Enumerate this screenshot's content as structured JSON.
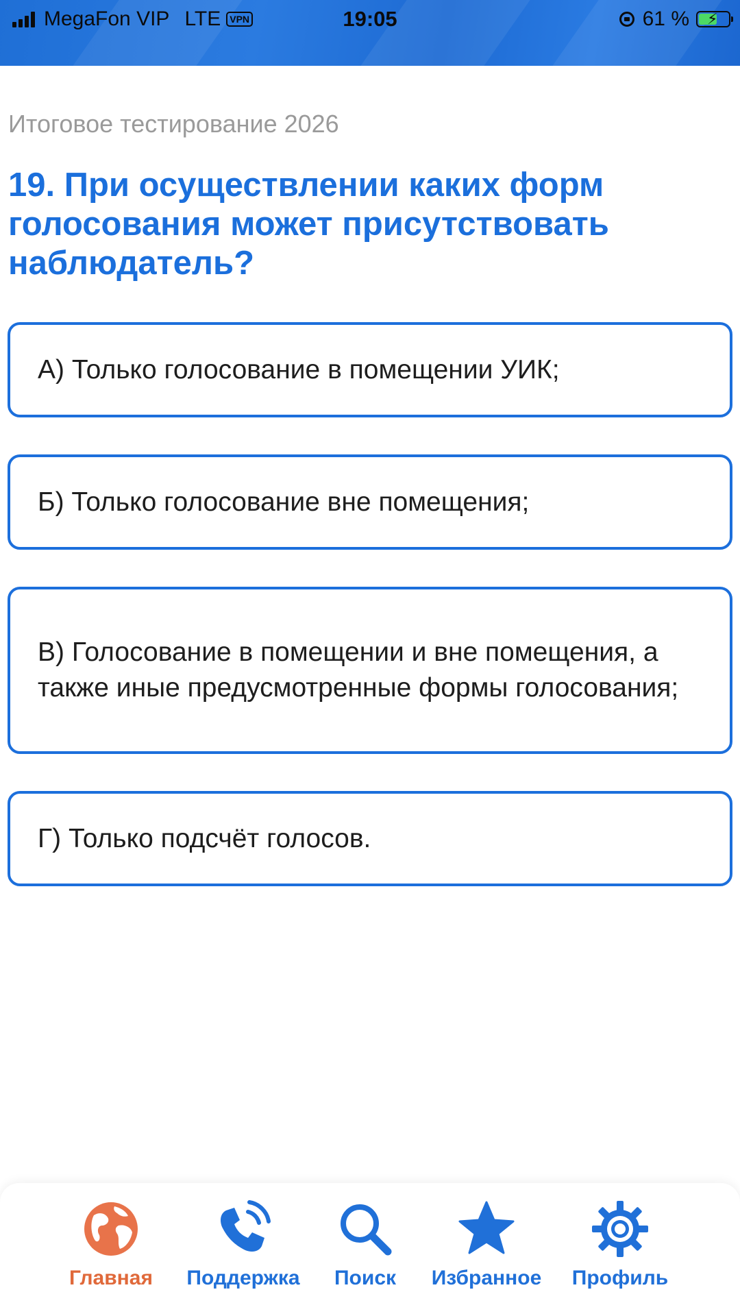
{
  "status_bar": {
    "carrier": "MegaFon VIP",
    "network": "LTE",
    "vpn": "VPN",
    "time": "19:05",
    "battery_percent": "61 %",
    "battery_level": 0.61,
    "battery_color": "#4cd964"
  },
  "header": {
    "subtitle": "Итоговое тестирование 2026"
  },
  "question": {
    "text": "19. При осуществлении каких форм голосования может присутствовать наблюдатель?"
  },
  "options": [
    {
      "text": "А) Только голосование в помещении УИК;"
    },
    {
      "text": "Б) Только голосование вне помещения;"
    },
    {
      "text": "В) Голосование в помещении и вне помещения, а также иные предусмотренные формы голосования;"
    },
    {
      "text": "Г) Только подсчёт голосов."
    }
  ],
  "tabbar": {
    "items": [
      {
        "label": "Главная",
        "icon": "globe-icon",
        "active": true
      },
      {
        "label": "Поддержка",
        "icon": "phone-icon",
        "active": false
      },
      {
        "label": "Поиск",
        "icon": "search-icon",
        "active": false
      },
      {
        "label": "Избранное",
        "icon": "star-icon",
        "active": false
      },
      {
        "label": "Профиль",
        "icon": "gear-icon",
        "active": false
      }
    ]
  },
  "colors": {
    "accent": "#1b6fdc",
    "active_tab": "#e0693a",
    "status_bar": "#1f6fd6",
    "subtitle": "#9a9a9a"
  }
}
